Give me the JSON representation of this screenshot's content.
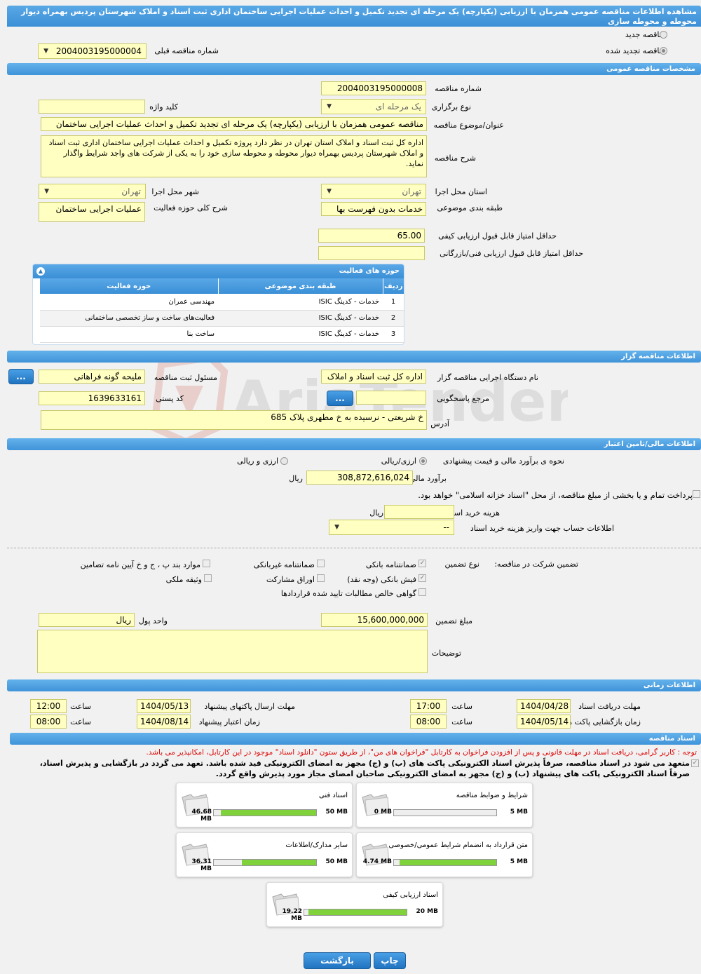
{
  "title": "مشاهده اطلاعات مناقصه عمومی همزمان با ارزیابی (یکپارچه) یک مرحله ای تجدید تکمیل و احداث عملیات اجرایی ساختمان اداری ثبت اسناد و املاک شهرستان پردیس بهمراه دیوار محوطه و محوطه سازی",
  "top": {
    "new_label": "مناقصه جدید",
    "renewed_label": "مناقصه تجدید شده",
    "prev_label": "شماره مناقصه قبلی",
    "prev_value": "2004003195000004"
  },
  "sections": {
    "general": "مشخصات مناقصه عمومی",
    "organizer": "اطلاعات مناقصه گزار",
    "finance": "اطلاعات مالی/تامین اعتبار",
    "time": "اطلاعات زمانی",
    "docs": "اسناد مناقصه"
  },
  "general": {
    "number_label": "شماره مناقصه",
    "number": "2004003195000008",
    "type_label": "نوع برگزاری",
    "type": "یک مرحله ای",
    "keyword_label": "کلید واژه",
    "keyword": "",
    "subject_label": "عنوان/موضوع مناقصه",
    "subject": "مناقصه عمومی همزمان با ارزیابی (یکپارچه) یک مرحله ای تجدید تکمیل و احداث عملیات اجرایی ساختمان",
    "desc_label": "شرح مناقصه",
    "desc": "اداره کل ثبت اسناد و املاک استان تهران در نظر دارد پروژه تکمیل و احداث عملیات اجرایی ساختمان اداری ثبت اسناد و املاک شهرستان پردیس بهمراه دیوار محوطه و محوطه سازی خود را به یکی از شرکت های واجد شرایط واگذار نماید.",
    "province_label": "استان محل اجرا",
    "province": "تهران",
    "city_label": "شهر محل اجرا",
    "city": "تهران",
    "category_label": "طبقه بندی موضوعی",
    "category": "خدمات بدون فهرست بها",
    "scope_label": "شرح کلی حوزه فعالیت",
    "scope": "عملیات اجرایی ساختمان",
    "quality_label": "حداقل امتیاز قابل قبول ارزیابی کیفی",
    "quality": "65.00",
    "tech_label": "حداقل امتیاز قابل قبول ارزیابی فنی/بازرگانی",
    "tech": ""
  },
  "activity": {
    "title": "حوزه های فعالیت",
    "cols": [
      "ردیف",
      "طبقه بندی موضوعی",
      "حوزه فعالیت"
    ],
    "rows": [
      [
        "1",
        "خدمات - کدینگ ISIC",
        "مهندسی عمران"
      ],
      [
        "2",
        "خدمات - کدینگ ISIC",
        "فعالیت‌های ساخت و ساز تخصصی ساختمانی"
      ],
      [
        "3",
        "خدمات - کدینگ ISIC",
        "ساخت بنا"
      ]
    ]
  },
  "organizer": {
    "org_label": "نام دستگاه اجرایی مناقصه گزار",
    "org": "اداره کل ثبت اسناد و املاک",
    "resp_label": "مسئول ثبت مناقصه",
    "resp": "ملیحه گونه فراهانی",
    "ref_label": "مرجع پاسخگویی",
    "ref": "",
    "postal_label": "کد پستی",
    "postal": "1639633161",
    "addr_label": "آدرس",
    "addr": "خ شریعتی - نرسیده به خ مطهری پلاک 685",
    "dots": "..."
  },
  "finance": {
    "method_label": "نحوه ی برآورد مالی و قیمت پیشنهادی",
    "opt1": "ارزی/ریالی",
    "opt2": "ارزی و ریالی",
    "estimate_label": "برآورد مالی",
    "estimate": "308,872,616,024",
    "rial": "ریال",
    "pay_text": "پرداخت تمام و یا بخشی از مبلغ مناقصه، از محل \"اسناد خزانه اسلامی\" خواهد بود.",
    "doc_cost_label": "هزینه خرید اسناد",
    "doc_cost": "",
    "account_label": "اطلاعات حساب جهت واریز هزینه خرید اسناد",
    "account": "--"
  },
  "guarantee": {
    "label": "تضمین شرکت در مناقصه:",
    "type_label": "نوع تضمین",
    "items": [
      "ضمانتنامه بانکی",
      "ضمانتنامه غیربانکی",
      "موارد بند پ ، ج و خ آیین نامه تضامین",
      "فیش بانکی (وجه نقد)",
      "اوراق مشارکت",
      "وثیقه ملکی",
      "گواهی خالص مطالبات تایید شده قراردادها"
    ],
    "amount_label": "مبلغ تضمین",
    "amount": "15,600,000,000",
    "unit_label": "واحد پول",
    "unit": "ریال",
    "notes_label": "توضیحات",
    "notes": ""
  },
  "time": {
    "receive_label": "مهلت دریافت اسناد",
    "receive_date": "1404/04/28",
    "receive_time": "17:00",
    "send_label": "مهلت ارسال پاکتهای پیشنهاد",
    "send_date": "1404/05/13",
    "send_time": "12:00",
    "open_label": "زمان بازگشایی پاکت ها",
    "open_date": "1404/05/14",
    "open_time": "08:00",
    "valid_label": "زمان اعتبار پیشنهاد",
    "valid_date": "1404/08/14",
    "valid_time": "08:00",
    "hour_label": "ساعت"
  },
  "docs": {
    "notice": "توجه : کاربر گرامی، دریافت اسناد در مهلت قانونی و پس از افزودن فراخوان به کارتابل \"فراخوان های من\"، از طریق ستون \"دانلود اسناد\" موجود در این کارتابل، امکانپذیر می باشد.",
    "commit1": "متعهد می شود در اسناد مناقصه، صرفاً پذیرش اسناد الکترونیکی پاکت های (ب) و (ج) مجهز به امضای الکترونیکی قید شده باشد. تعهد می گردد در بازگشایی و پذیرش اسناد،",
    "commit2": "صرفاً اسناد الکترونیکی پاکت های پیشنهاد (ب) و (ج) مجهز به امضای الکترونیکی صاحبان امضای مجاز مورد پذیرش واقع گردد.",
    "files": [
      {
        "name": "شرایط و ضوابط مناقصه",
        "max": "5 MB",
        "cur": "0 MB",
        "pct": 0
      },
      {
        "name": "اسناد فنی",
        "max": "50 MB",
        "cur": "46.68 MB",
        "pct": 0.9336
      },
      {
        "name": "متن قرارداد به انضمام شرایط عمومی/خصوصی",
        "max": "5 MB",
        "cur": "4.74 MB",
        "pct": 0.948
      },
      {
        "name": "سایر مدارک/اطلاعات",
        "max": "50 MB",
        "cur": "36.31 MB",
        "pct": 0.7262
      },
      {
        "name": "اسناد ارزیابی کیفی",
        "max": "20 MB",
        "cur": "19.22 MB",
        "pct": 0.961
      }
    ]
  },
  "buttons": {
    "print": "چاپ",
    "back": "بازگشت"
  },
  "watermark": "AriaTender.neT"
}
